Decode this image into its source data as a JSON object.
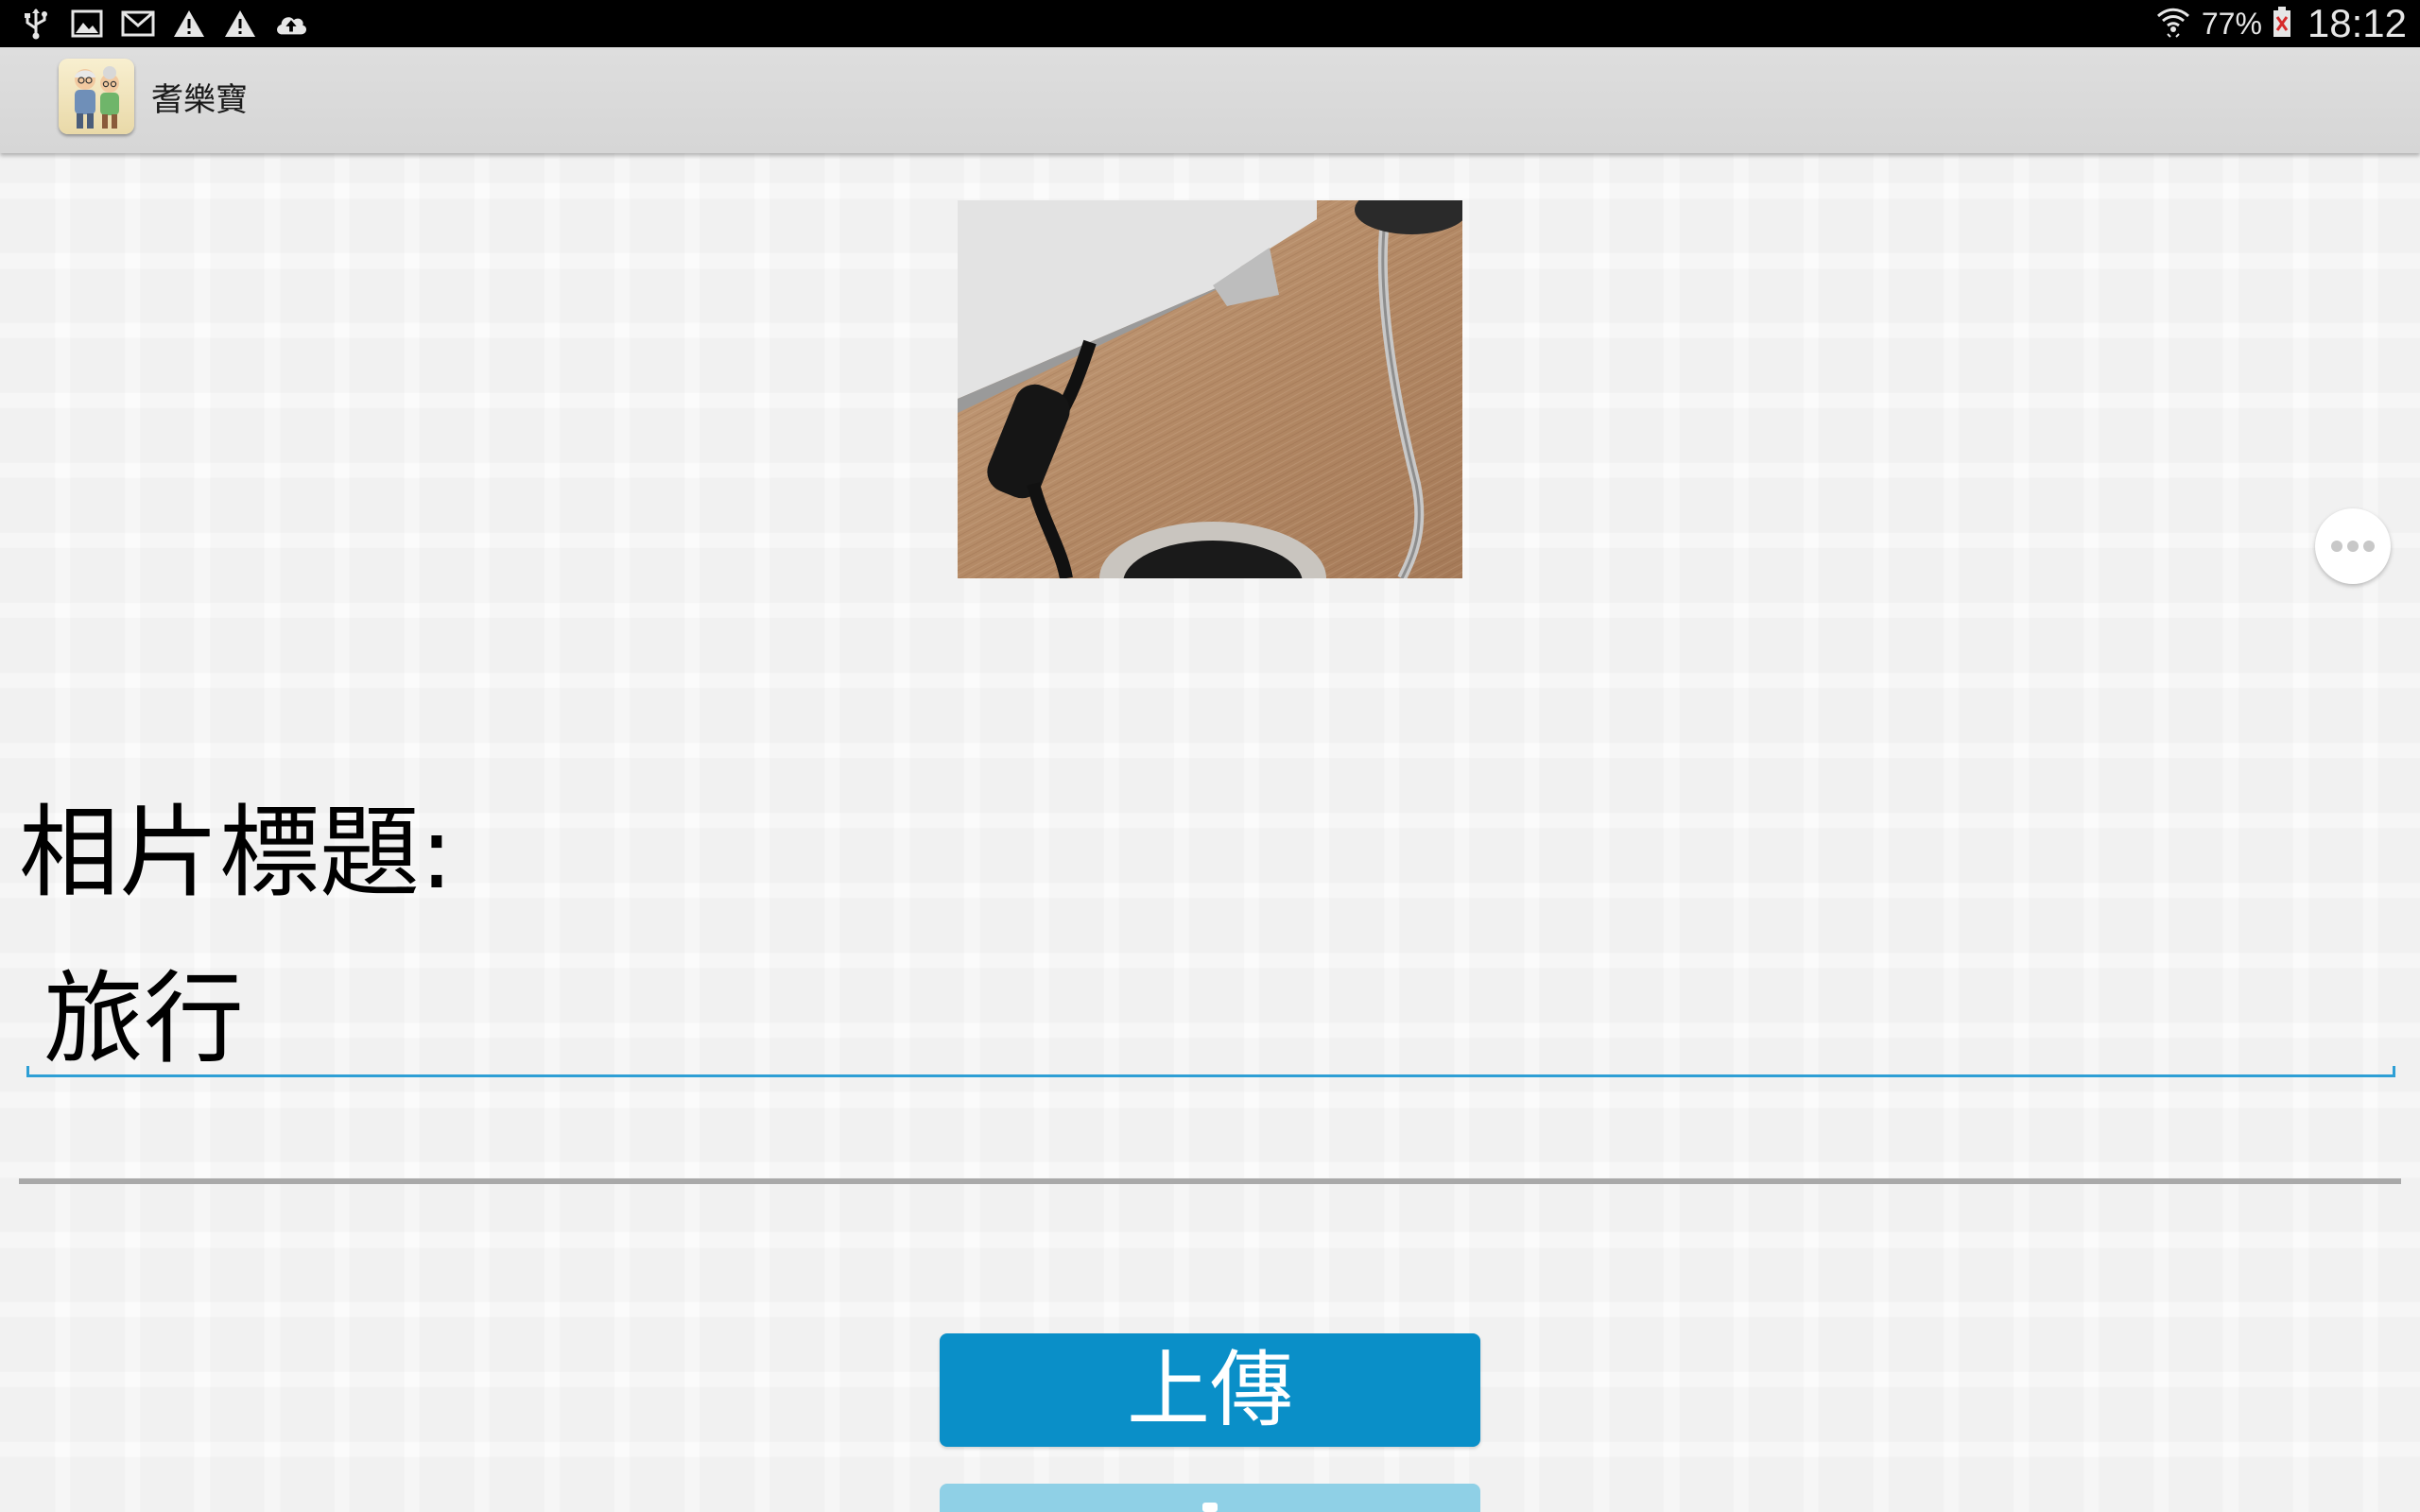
{
  "status_bar": {
    "left_icons": [
      "usb-icon",
      "image-icon",
      "gmail-icon",
      "warning-icon",
      "warning-icon",
      "cloud-upload-icon"
    ],
    "battery_percent": "77%",
    "time": "18:12"
  },
  "action_bar": {
    "app_title": "耆樂寶",
    "app_icon": "elderly-couple-icon"
  },
  "photo": {
    "subject": "desk-cable-photo"
  },
  "form": {
    "title_label": "相片標題:",
    "title_value": "旅行"
  },
  "buttons": {
    "upload_label": "上傳"
  },
  "colors": {
    "accent": "#0a8fc8",
    "input_underline": "#2e9fd5",
    "status_bar": "#000000",
    "action_bar": "#dadada"
  }
}
